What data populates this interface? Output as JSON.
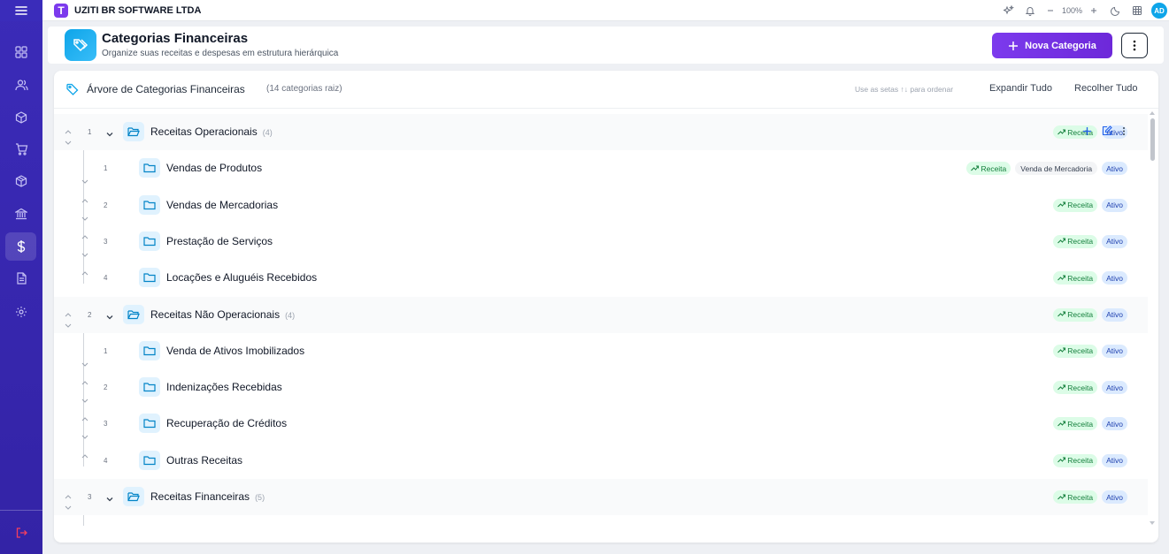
{
  "app": {
    "company": "UZITI BR SOFTWARE LTDA",
    "logo_letter": "T",
    "zoom": "100%",
    "avatar": "AD"
  },
  "sidebar": {
    "items": [
      "dashboard-icon",
      "users-icon",
      "box-icon",
      "cart-icon",
      "package-icon",
      "bank-icon",
      "dollar-icon",
      "document-icon",
      "settings-icon"
    ],
    "active": "dollar-icon",
    "logout": "logout-icon"
  },
  "header": {
    "title": "Categorias Financeiras",
    "subtitle": "Organize suas receitas e despesas em estrutura hierárquica",
    "new_button": "Nova Categoria"
  },
  "tree": {
    "title": "Árvore de Categorias Financeiras",
    "count": "(14 categorias raiz)",
    "hint": "Use as setas ↑↓ para ordenar",
    "expand_all": "Expandir Tudo",
    "collapse_all": "Recolher Tudo",
    "groups": [
      {
        "num": "1",
        "name": "Receitas Operacionais",
        "count": "(4)",
        "type": "Receita",
        "status": "Ativo",
        "children": [
          {
            "num": "1",
            "name": "Vendas de Produtos",
            "type": "Receita",
            "tag": "Venda de Mercadoria",
            "status": "Ativo"
          },
          {
            "num": "2",
            "name": "Vendas de Mercadorias",
            "type": "Receita",
            "status": "Ativo"
          },
          {
            "num": "3",
            "name": "Prestação de Serviços",
            "type": "Receita",
            "status": "Ativo"
          },
          {
            "num": "4",
            "name": "Locações e Aluguéis Recebidos",
            "type": "Receita",
            "status": "Ativo"
          }
        ]
      },
      {
        "num": "2",
        "name": "Receitas Não Operacionais",
        "count": "(4)",
        "type": "Receita",
        "status": "Ativo",
        "children": [
          {
            "num": "1",
            "name": "Venda de Ativos Imobilizados",
            "type": "Receita",
            "status": "Ativo"
          },
          {
            "num": "2",
            "name": "Indenizações Recebidas",
            "type": "Receita",
            "status": "Ativo"
          },
          {
            "num": "3",
            "name": "Recuperação de Créditos",
            "type": "Receita",
            "status": "Ativo"
          },
          {
            "num": "4",
            "name": "Outras Receitas",
            "type": "Receita",
            "status": "Ativo"
          }
        ]
      },
      {
        "num": "3",
        "name": "Receitas Financeiras",
        "count": "(5)",
        "type": "Receita",
        "status": "Ativo",
        "children": []
      }
    ]
  },
  "colors": {
    "sidebar": "#3b2bb8",
    "primary": "#7c3aed",
    "accent": "#0ea5e9",
    "receita_bg": "#dcfce7",
    "receita_fg": "#15803d",
    "ativo_bg": "#dbeafe",
    "ativo_fg": "#1e40af"
  }
}
